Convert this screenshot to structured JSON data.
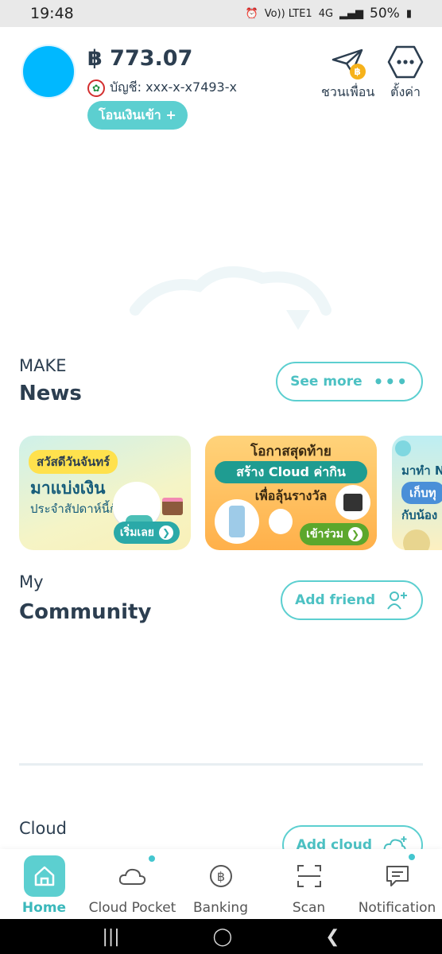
{
  "status_bar": {
    "time": "19:48",
    "network": "Vo)) LTE1",
    "signal_type": "4G",
    "battery": "50%"
  },
  "header": {
    "balance": "฿ 773.07",
    "account": "บัญชี: xxx-x-x7493-x",
    "topup_label": "โอนเงินเข้า +",
    "invite_label": "ชวนเพื่อน",
    "settings_label": "ตั้งค่า",
    "coin_symbol": "฿"
  },
  "news": {
    "small": "MAKE",
    "title": "News",
    "see_more": "See more",
    "banners": [
      {
        "chip": "สวัสดีวันจันทร์",
        "headline": "มาแบ่งเงิน",
        "sub": "ประจำสัปดาห์นี้กัน",
        "cta": "เริ่มเลย"
      },
      {
        "top": "โอกาสสุดท้าย",
        "chip": "สร้าง Cloud ค่ากิน",
        "sub": "เพื่อลุ้นรางวัล",
        "cta": "เข้าร่วม"
      },
      {
        "line1": "มาทำ N",
        "chip": "เก็บทุ",
        "line2": "กับน้อง"
      }
    ]
  },
  "community": {
    "small": "My",
    "title": "Community",
    "add_friend": "Add friend"
  },
  "cloud": {
    "small": "Cloud",
    "add_cloud": "Add cloud"
  },
  "bottom_nav": [
    {
      "label": "Home",
      "icon": "home-icon",
      "active": true
    },
    {
      "label": "Cloud Pocket",
      "icon": "cloud-icon",
      "active": false
    },
    {
      "label": "Banking",
      "icon": "baht-coin-icon",
      "active": false
    },
    {
      "label": "Scan",
      "icon": "scan-icon",
      "active": false
    },
    {
      "label": "Notification",
      "icon": "message-icon",
      "active": false
    }
  ],
  "colors": {
    "accent": "#5ccfd0",
    "avatar": "#00b8ff",
    "text": "#2c3e50"
  }
}
